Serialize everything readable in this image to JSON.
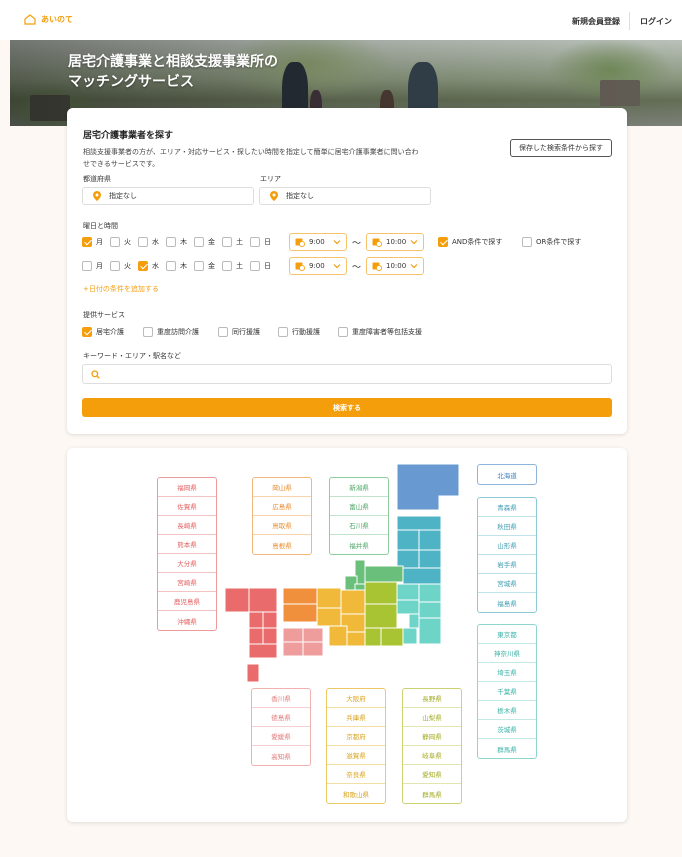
{
  "header": {
    "logo_text": "あいのて",
    "signup_label": "新規会員登録",
    "login_label": "ログイン"
  },
  "hero": {
    "title_line1": "居宅介護事業と相談支援事業所の",
    "title_line2": "マッチングサービス"
  },
  "search": {
    "title": "居宅介護事業者を探す",
    "description": "相談支援事業者の方が、エリア・対応サービス・探したい時間を指定して簡単に居宅介護事業者に問い合わせできるサービスです。",
    "saved_button": "保存した検索条件から探す",
    "prefecture_label": "都道府県",
    "prefecture_value": "指定なし",
    "area_label": "エリア",
    "area_value": "指定なし",
    "day_time_label": "曜日と時間",
    "rows": [
      {
        "days": [
          {
            "label": "月",
            "checked": true
          },
          {
            "label": "火",
            "checked": false
          },
          {
            "label": "水",
            "checked": false
          },
          {
            "label": "木",
            "checked": false
          },
          {
            "label": "金",
            "checked": false
          },
          {
            "label": "土",
            "checked": false
          },
          {
            "label": "日",
            "checked": false
          }
        ],
        "start": "9:00",
        "end": "10:00"
      },
      {
        "days": [
          {
            "label": "月",
            "checked": false
          },
          {
            "label": "火",
            "checked": false
          },
          {
            "label": "水",
            "checked": true
          },
          {
            "label": "木",
            "checked": false
          },
          {
            "label": "金",
            "checked": false
          },
          {
            "label": "土",
            "checked": false
          },
          {
            "label": "日",
            "checked": false
          }
        ],
        "start": "9:00",
        "end": "10:00"
      }
    ],
    "tilde": "〜",
    "and_label": "AND条件で探す",
    "or_label": "OR条件で探す",
    "add_date_link": "+日付の条件を追加する",
    "service_label": "提供サービス",
    "services": [
      {
        "label": "居宅介護",
        "checked": true
      },
      {
        "label": "重度訪問介護",
        "checked": false
      },
      {
        "label": "同行援護",
        "checked": false
      },
      {
        "label": "行動援護",
        "checked": false
      },
      {
        "label": "重度障害者等包括支援",
        "checked": false
      }
    ],
    "keyword_label": "キーワード・エリア・駅名など",
    "keyword_value": "",
    "search_button": "検索する"
  },
  "map": {
    "kyushu": [
      "福岡県",
      "佐賀県",
      "長崎県",
      "熊本県",
      "大分県",
      "宮崎県",
      "鹿児島県",
      "沖縄県"
    ],
    "chugoku": [
      "岡山県",
      "広島県",
      "鳥取県",
      "島根県"
    ],
    "chubu": [
      "新潟県",
      "富山県",
      "石川県",
      "福井県"
    ],
    "hokkaido": [
      "北海道"
    ],
    "tohoku": [
      "青森県",
      "秋田県",
      "山形県",
      "岩手県",
      "宮城県",
      "福島県"
    ],
    "kanto": [
      "東京都",
      "神奈川県",
      "埼玉県",
      "千葉県",
      "栃木県",
      "茨城県",
      "群馬県"
    ],
    "shikoku": [
      "香川県",
      "徳島県",
      "愛媛県",
      "高知県"
    ],
    "kinki": [
      "大阪府",
      "兵庫県",
      "京都府",
      "滋賀県",
      "奈良県",
      "和歌山県"
    ],
    "koshin": [
      "長野県",
      "山梨県",
      "静岡県",
      "岐阜県",
      "愛知県",
      "群馬県"
    ]
  },
  "colors": {
    "accent": "#f59e0b",
    "kyushu": "#e96b6b",
    "chugoku": "#f08f3c",
    "kinki": "#f0b93a",
    "chubu": "#6abf7b",
    "koshin": "#a8c432",
    "tohoku": "#4fb3c6",
    "kanto": "#6fd4c8",
    "hokkaido": "#6899d0",
    "shikoku": "#ee9c9c"
  }
}
